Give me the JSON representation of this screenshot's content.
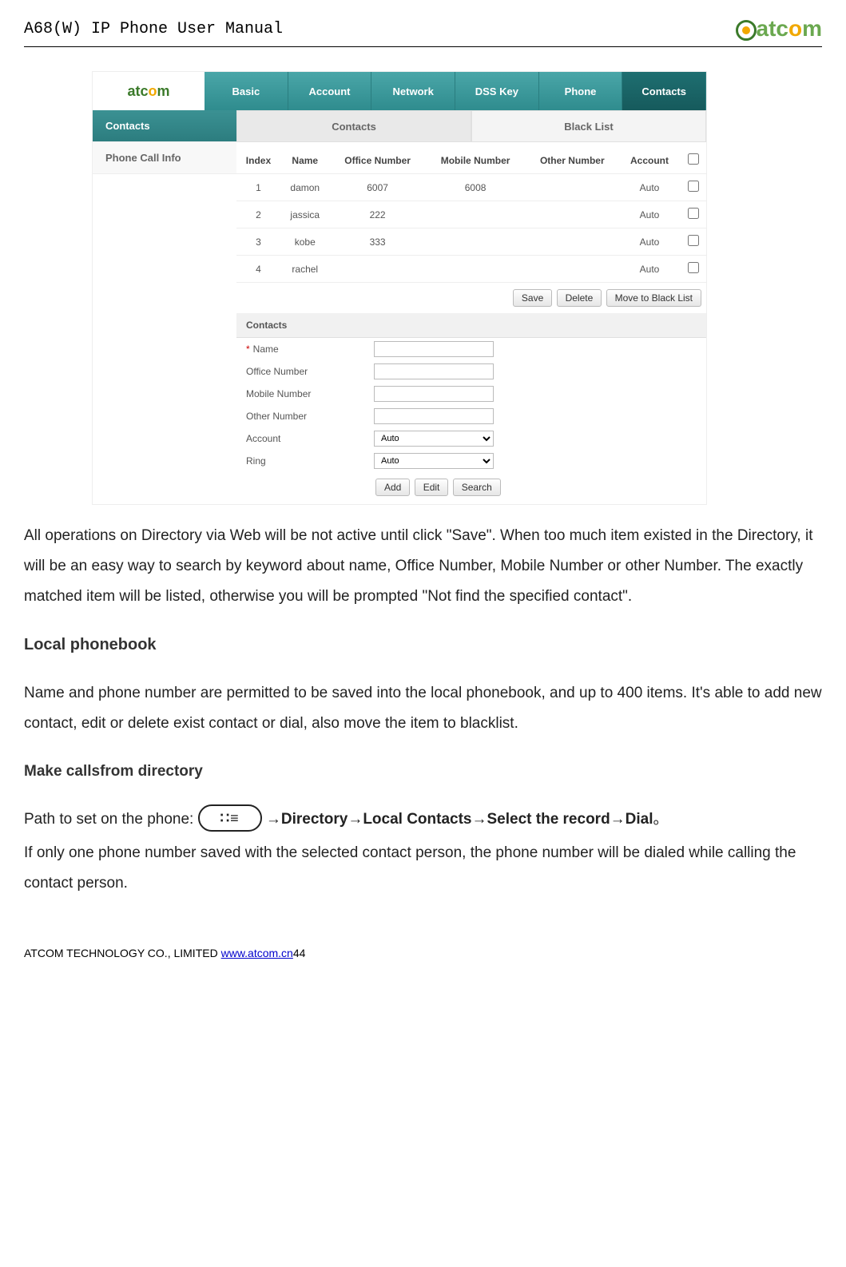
{
  "doc": {
    "title": "A68(W) IP Phone User Manual",
    "logo_text_parts": {
      "a1": "a",
      "t": "t",
      "c": "c",
      "o": "o",
      "m": "m"
    }
  },
  "screenshot": {
    "brand_logo": "atcom",
    "nav": [
      "Basic",
      "Account",
      "Network",
      "DSS Key",
      "Phone",
      "Contacts"
    ],
    "active_nav": "Contacts",
    "sidebar": [
      "Contacts",
      "Phone Call Info"
    ],
    "active_sidebar": "Contacts",
    "subtabs": [
      "Contacts",
      "Black List"
    ],
    "active_subtab": "Contacts",
    "table": {
      "headers": [
        "Index",
        "Name",
        "Office Number",
        "Mobile Number",
        "Other Number",
        "Account",
        ""
      ],
      "rows": [
        {
          "index": "1",
          "name": "damon",
          "office": "6007",
          "mobile": "6008",
          "other": "",
          "account": "Auto"
        },
        {
          "index": "2",
          "name": "jassica",
          "office": "222",
          "mobile": "",
          "other": "",
          "account": "Auto"
        },
        {
          "index": "3",
          "name": "kobe",
          "office": "333",
          "mobile": "",
          "other": "",
          "account": "Auto"
        },
        {
          "index": "4",
          "name": "rachel",
          "office": "",
          "mobile": "",
          "other": "",
          "account": "Auto"
        }
      ]
    },
    "buttons_row1": {
      "save": "Save",
      "delete": "Delete",
      "move": "Move to Black List"
    },
    "form_header": "Contacts",
    "form": {
      "name_label": "Name",
      "office_label": "Office Number",
      "mobile_label": "Mobile Number",
      "other_label": "Other Number",
      "account_label": "Account",
      "ring_label": "Ring",
      "account_value": "Auto",
      "ring_value": "Auto"
    },
    "buttons_row2": {
      "add": "Add",
      "edit": "Edit",
      "search": "Search"
    }
  },
  "body": {
    "para1": "All operations on Directory via Web will be not active until click \"Save\". When too much item existed in the Directory, it will be an easy way to search by keyword about name, Office Number, Mobile Number or other Number. The exactly matched item will be listed, otherwise you will be prompted \"Not find the specified contact\".",
    "heading_local": "Local phonebook",
    "para2": "Name and phone number are permitted to be saved into the local phonebook, and up to 400 items.  It's able to add new contact, edit or delete exist contact or dial, also move the item to blacklist.",
    "heading_make": "Make callsfrom directory",
    "path_intro": "Path to set on the phone: ",
    "path_bold": "→Directory→Local Contacts→Select the record→Dial",
    "path_end": "。",
    "para3": "If only one phone number saved with the selected contact person, the phone number will be dialed while calling the contact person."
  },
  "footer": {
    "company": "ATCOM TECHNOLOGY CO., LIMITED ",
    "url_text": "www.atcom.cn",
    "page": "44"
  }
}
